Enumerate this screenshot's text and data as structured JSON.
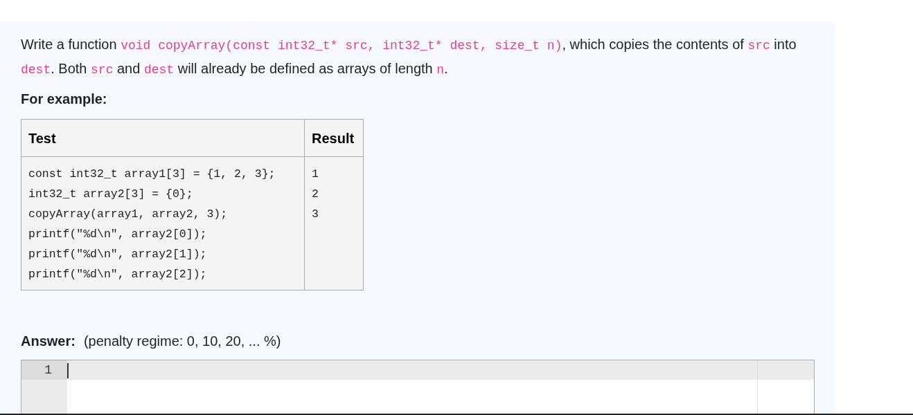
{
  "question": {
    "paragraph": [
      {
        "kind": "text",
        "text": "Write a function "
      },
      {
        "kind": "code",
        "text": "void copyArray(const int32_t* src, int32_t* dest, size_t n)"
      },
      {
        "kind": "text",
        "text": ", which copies the contents of "
      },
      {
        "kind": "code",
        "text": "src"
      },
      {
        "kind": "text",
        "text": " into "
      },
      {
        "kind": "code",
        "text": "dest"
      },
      {
        "kind": "text",
        "text": ". Both "
      },
      {
        "kind": "code",
        "text": "src"
      },
      {
        "kind": "text",
        "text": " and "
      },
      {
        "kind": "code",
        "text": "dest"
      },
      {
        "kind": "text",
        "text": " will already be defined as arrays of length "
      },
      {
        "kind": "code",
        "text": "n"
      },
      {
        "kind": "text",
        "text": "."
      }
    ],
    "example_heading": "For example:",
    "table": {
      "columns": [
        "Test",
        "Result"
      ],
      "rows": [
        {
          "test": [
            "const int32_t array1[3] = {1, 2, 3};",
            "int32_t array2[3] = {0};",
            "copyArray(array1, array2, 3);",
            "printf(\"%d\\n\", array2[0]);",
            "printf(\"%d\\n\", array2[1]);",
            "printf(\"%d\\n\", array2[2]);"
          ],
          "result": [
            "1",
            "2",
            "3"
          ]
        }
      ]
    }
  },
  "answer": {
    "label": "Answer:",
    "penalty": "(penalty regime: 0, 10, 20, ... %)",
    "editor": {
      "line_numbers": [
        "1"
      ]
    }
  }
}
